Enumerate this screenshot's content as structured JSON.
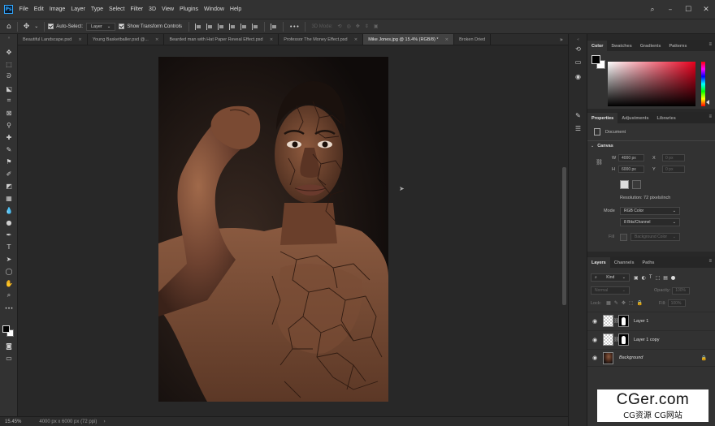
{
  "app": {
    "logo": "Ps"
  },
  "menu": [
    "File",
    "Edit",
    "Image",
    "Layer",
    "Type",
    "Select",
    "Filter",
    "3D",
    "View",
    "Plugins",
    "Window",
    "Help"
  ],
  "window_controls": {
    "search": "search-icon",
    "minimize": "–",
    "maximize": "☐",
    "close": "✕"
  },
  "options_bar": {
    "auto_select_label": "Auto-Select:",
    "auto_select_value": "Layer",
    "show_transform_label": "Show Transform Controls",
    "three_d_mode_label": "3D Mode:",
    "more": "•••"
  },
  "tabs": [
    {
      "label": "Beautiful Landscape.psd",
      "active": false
    },
    {
      "label": "Young Basketballer.psd @...",
      "active": false
    },
    {
      "label": "Bearded man with Hat Paper Reveal Effect.psd",
      "active": false
    },
    {
      "label": "Professor The Money Effect.psd",
      "active": false
    },
    {
      "label": "Mike Jones.jpg @ 15.4% (RGB/8) *",
      "active": true
    },
    {
      "label": "Broken Dried",
      "active": false
    }
  ],
  "tabs_overflow": "»",
  "status": {
    "zoom": "15.45%",
    "doc_size": "4000 px x 6000 px (72 ppi)"
  },
  "color_panel": {
    "tabs": [
      "Color",
      "Swatches",
      "Gradients",
      "Patterns"
    ],
    "fg_color": "#000000",
    "bg_color": "#ffffff",
    "hue_color": "#e8001d"
  },
  "properties": {
    "tabs": [
      "Properties",
      "Adjustments",
      "Libraries"
    ],
    "type_label": "Document",
    "section": "Canvas",
    "w_label": "W",
    "w_value": "4000 px",
    "h_label": "H",
    "h_value": "6000 px",
    "x_label": "X",
    "x_value": "0 px",
    "y_label": "Y",
    "y_value": "0 px",
    "resolution": "Resolution: 72 pixels/inch",
    "mode_label": "Mode",
    "mode_value": "RGB Color",
    "bits_value": "8 Bits/Channel",
    "fill_label": "Fill",
    "fill_value": "Background Color"
  },
  "layers_panel": {
    "tabs": [
      "Layers",
      "Channels",
      "Paths"
    ],
    "filter_label": "Kind",
    "blend_mode": "Normal",
    "opacity_label": "Opacity:",
    "opacity_value": "100%",
    "lock_label": "Lock:",
    "fill_label": "Fill:",
    "fill_value": "100%",
    "layers": [
      {
        "name": "Layer 1",
        "italic": false,
        "has_mask": true,
        "thumb": "transparent"
      },
      {
        "name": "Layer 1 copy",
        "italic": false,
        "has_mask": true,
        "thumb": "transparent"
      },
      {
        "name": "Background",
        "italic": true,
        "has_mask": false,
        "thumb": "photo",
        "locked": true
      }
    ]
  },
  "watermark": {
    "main": "CGer.com",
    "sub": "CG资源 CG网站"
  }
}
